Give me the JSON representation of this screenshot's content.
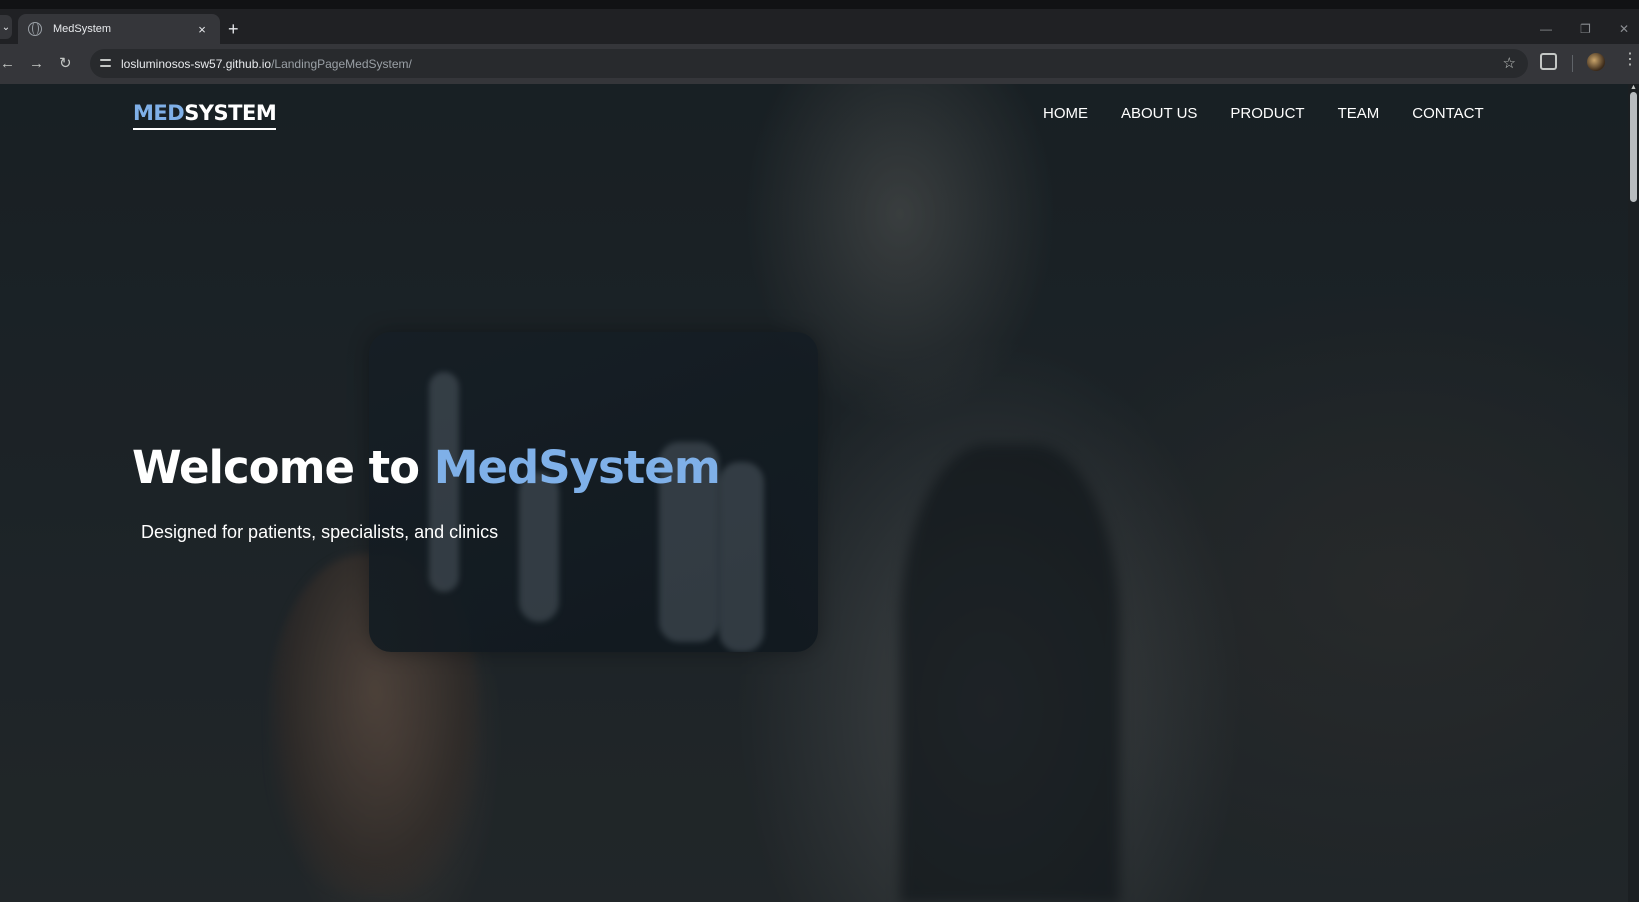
{
  "browser": {
    "tab": {
      "title": "MedSystem",
      "close_icon": "×"
    },
    "new_tab_icon": "+",
    "window_controls": {
      "minimize": "—",
      "restore": "❐",
      "close": "✕"
    },
    "address": {
      "domain": "losluminosos-sw57.github.io",
      "path": "/LandingPageMedSystem/"
    }
  },
  "page": {
    "brand": {
      "part1": "MED",
      "part2": "SYSTEM"
    },
    "nav": [
      "HOME",
      "ABOUT US",
      "PRODUCT",
      "TEAM",
      "CONTACT"
    ],
    "hero": {
      "title_prefix": "Welcome to ",
      "title_accent": "MedSystem",
      "subtitle": "Designed for patients, specialists, and clinics"
    },
    "colors": {
      "accent": "#7fb0e8",
      "text": "#ffffff",
      "overlay": "#1c2327"
    }
  }
}
